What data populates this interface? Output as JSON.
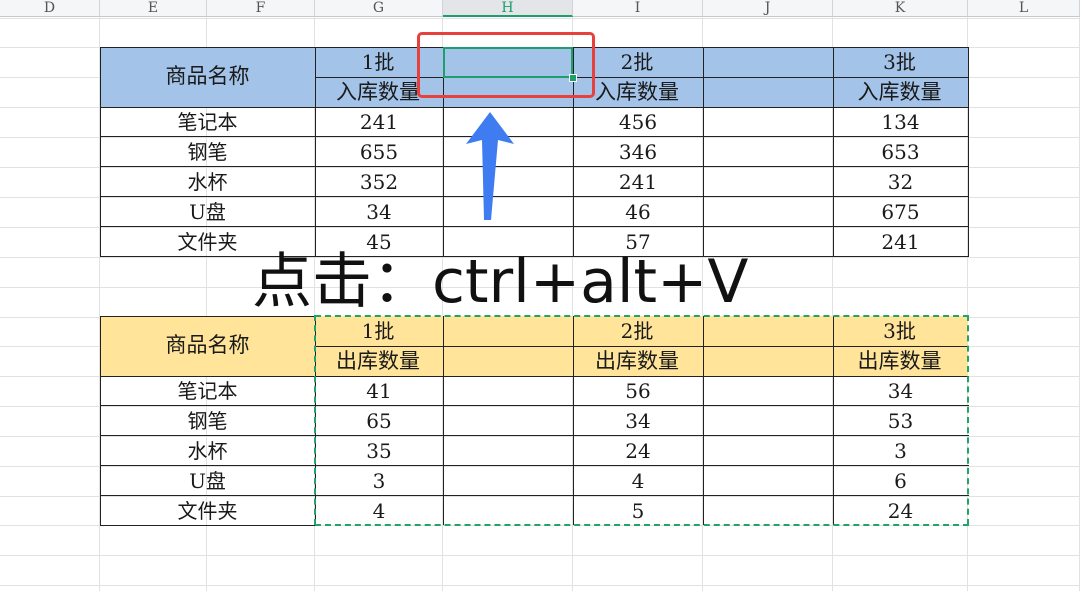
{
  "column_headers": [
    "D",
    "E",
    "F",
    "G",
    "H",
    "I",
    "J",
    "K",
    "L"
  ],
  "selected_column": "H",
  "instruction": "点击：ctrl+alt+V",
  "colors": {
    "inbound_header_fill": "#a3c3e8",
    "outbound_header_fill": "#ffe49a",
    "selection_green": "#1e9e6a",
    "copy_marquee_green": "#22a36b",
    "highlight_red": "#e8403c",
    "arrow_blue": "#3f7cf2"
  },
  "inbound_table": {
    "name_header": "商品名称",
    "batches": [
      "1批",
      "2批",
      "3批"
    ],
    "quantity_label": "入库数量",
    "rows": [
      {
        "name": "笔记本",
        "values": [
          "241",
          "456",
          "134"
        ]
      },
      {
        "name": "钢笔",
        "values": [
          "655",
          "346",
          "653"
        ]
      },
      {
        "name": "水杯",
        "values": [
          "352",
          "241",
          "32"
        ]
      },
      {
        "name": "U盘",
        "values": [
          "34",
          "46",
          "675"
        ]
      },
      {
        "name": "文件夹",
        "values": [
          "45",
          "57",
          "241"
        ]
      }
    ]
  },
  "outbound_table": {
    "name_header": "商品名称",
    "batches": [
      "1批",
      "2批",
      "3批"
    ],
    "quantity_label": "出库数量",
    "rows": [
      {
        "name": "笔记本",
        "values": [
          "41",
          "56",
          "34"
        ]
      },
      {
        "name": "钢笔",
        "values": [
          "65",
          "34",
          "53"
        ]
      },
      {
        "name": "水杯",
        "values": [
          "35",
          "24",
          "3"
        ]
      },
      {
        "name": "U盘",
        "values": [
          "3",
          "4",
          "6"
        ]
      },
      {
        "name": "文件夹",
        "values": [
          "4",
          "5",
          "24"
        ]
      }
    ]
  }
}
